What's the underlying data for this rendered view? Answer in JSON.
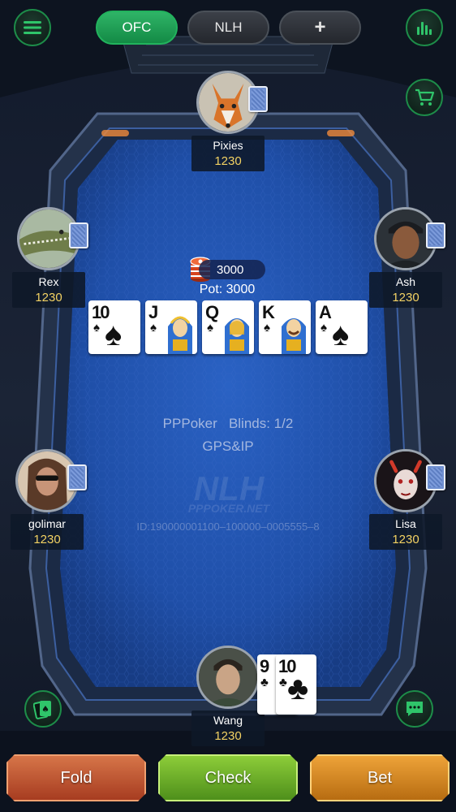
{
  "tabs": [
    {
      "label": "OFC",
      "active": true
    },
    {
      "label": "NLH",
      "active": false
    },
    {
      "label": "+",
      "active": false
    }
  ],
  "icons": {
    "menu": "menu-icon",
    "stats": "bar-chart-icon",
    "shop": "cart-icon",
    "cards": "cards-icon",
    "chat": "chat-icon"
  },
  "players": [
    {
      "name": "Pixies",
      "chips": "1230"
    },
    {
      "name": "Rex",
      "chips": "1230"
    },
    {
      "name": "Ash",
      "chips": "1230"
    },
    {
      "name": "golimar",
      "chips": "1230"
    },
    {
      "name": "Lisa",
      "chips": "1230"
    },
    {
      "name": "Wang",
      "chips": "1230"
    }
  ],
  "pot": {
    "chips": "3000",
    "label": "Pot: 3000"
  },
  "community_cards": [
    {
      "rank": "10",
      "suit": "♠"
    },
    {
      "rank": "J",
      "suit": "♠"
    },
    {
      "rank": "Q",
      "suit": "♠"
    },
    {
      "rank": "K",
      "suit": "♠"
    },
    {
      "rank": "A",
      "suit": "♠"
    }
  ],
  "hole_cards": [
    {
      "rank": "9",
      "suit": "♣"
    },
    {
      "rank": "10",
      "suit": "♣"
    }
  ],
  "table_info": {
    "brand": "PPPoker",
    "blinds": "Blinds: 1/2",
    "gps": "GPS&IP",
    "watermark": "NLH",
    "site": "PPPOKER.NET",
    "id": "ID:190000001100–100000–0005555–8"
  },
  "actions": {
    "fold": "Fold",
    "check": "Check",
    "bet": "Bet"
  },
  "colors": {
    "accent_green": "#22b35d",
    "felt": "#1f4fa8",
    "chips_text": "#f3d263",
    "fold": "#c0522f",
    "check": "#6aae2a",
    "bet": "#e08a1e"
  }
}
